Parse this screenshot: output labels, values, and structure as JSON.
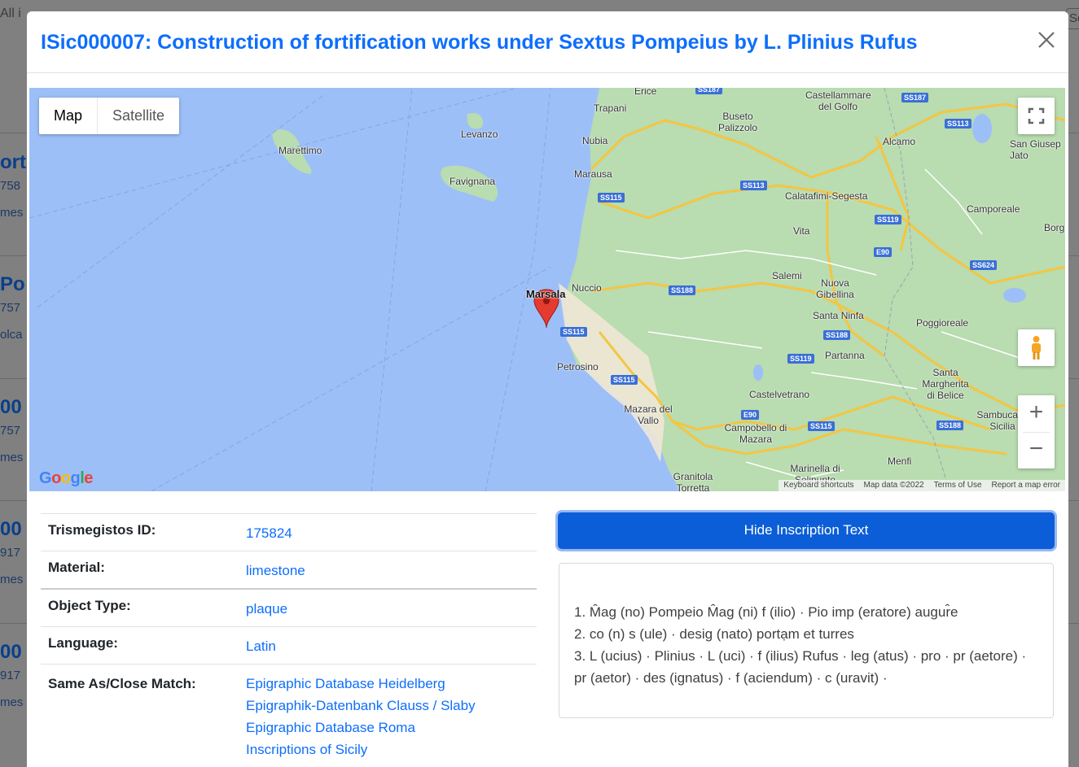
{
  "background": {
    "top_left_text": "All i",
    "top_right_text": "Se",
    "rows": [
      {
        "title": "ort",
        "line1": "758",
        "line2": "mes"
      },
      {
        "title": "Po",
        "line1": "757",
        "line2": "olca"
      },
      {
        "title": "00",
        "line1": "757",
        "line2": "mes"
      },
      {
        "title": "00",
        "line1": "917",
        "line2": "mes"
      },
      {
        "title": "00",
        "line1": "917",
        "line2": "mes"
      }
    ]
  },
  "modal": {
    "title": "ISic000007: Construction of fortification works under Sextus Pompeius by L. Plinius Rufus",
    "close_icon": "close-icon"
  },
  "map": {
    "type_options": [
      "Map",
      "Satellite"
    ],
    "selected_type": "Map",
    "marker_label": "Marsala",
    "places": [
      "Erice",
      "Trapani",
      "Buseto Palizzolo",
      "Castellammare del Golfo",
      "Alcamo",
      "San Giusep Jato",
      "Levanzo",
      "Marettimo",
      "Favignana",
      "Nubia",
      "Marausa",
      "Calatafimi-Segesta",
      "Camporeale",
      "Borg",
      "Vita",
      "Salemi",
      "Nuccio",
      "Nuova Gibellina",
      "Santa Ninfa",
      "Poggioreale",
      "Partanna",
      "Petrosino",
      "Santa Margherita di Belice",
      "Castelvetrano",
      "Mazara del Vallo",
      "Campobello di Mazara",
      "Sambuca di Sicilia",
      "Menfi",
      "Marinella di Selinunte",
      "Granitola Torretta"
    ],
    "roads": [
      "SS187",
      "SS113",
      "SS115",
      "SS119",
      "E90",
      "SS624",
      "SS188",
      "SS115",
      "SS188",
      "SS119",
      "SS115",
      "E90",
      "SS115",
      "SS188",
      "SS187",
      "SS113",
      "SS188"
    ],
    "attribution": [
      "Keyboard shortcuts",
      "Map data ©2022",
      "Terms of Use",
      "Report a map error"
    ],
    "logo": "Google",
    "zoom_in": "+",
    "zoom_out": "−"
  },
  "details": [
    {
      "key": "Trismegistos ID:",
      "value": "175824"
    },
    {
      "key": "Material:",
      "value": "limestone"
    },
    {
      "key": "Object Type:",
      "value": "plaque"
    },
    {
      "key": "Language:",
      "value": "Latin"
    }
  ],
  "same_as": {
    "key": "Same As/Close Match:",
    "links": [
      "Epigraphic Database Heidelberg",
      "Epigraphik-Datenbank Clauss / Slaby",
      "Epigraphic Database Roma",
      "Inscriptions of Sicily"
    ]
  },
  "inscription": {
    "button_label": "Hide Inscription Text",
    "lines": [
      "1. M̂ag (no) Pompeio M̂ag (ni) f (ilio) · Pio imp (eratore) augur̂e",
      "2. co (n) s (ule) · desig (nato) portạm et turres",
      "3. L (ucius) · Plinius · L (uci) · f (ilius) Rufus · leg (atus) · pro · pr (aetore) ·",
      "pr (aetor) · des (ignatus) · f (aciendum) · c (uravit) ·"
    ]
  }
}
